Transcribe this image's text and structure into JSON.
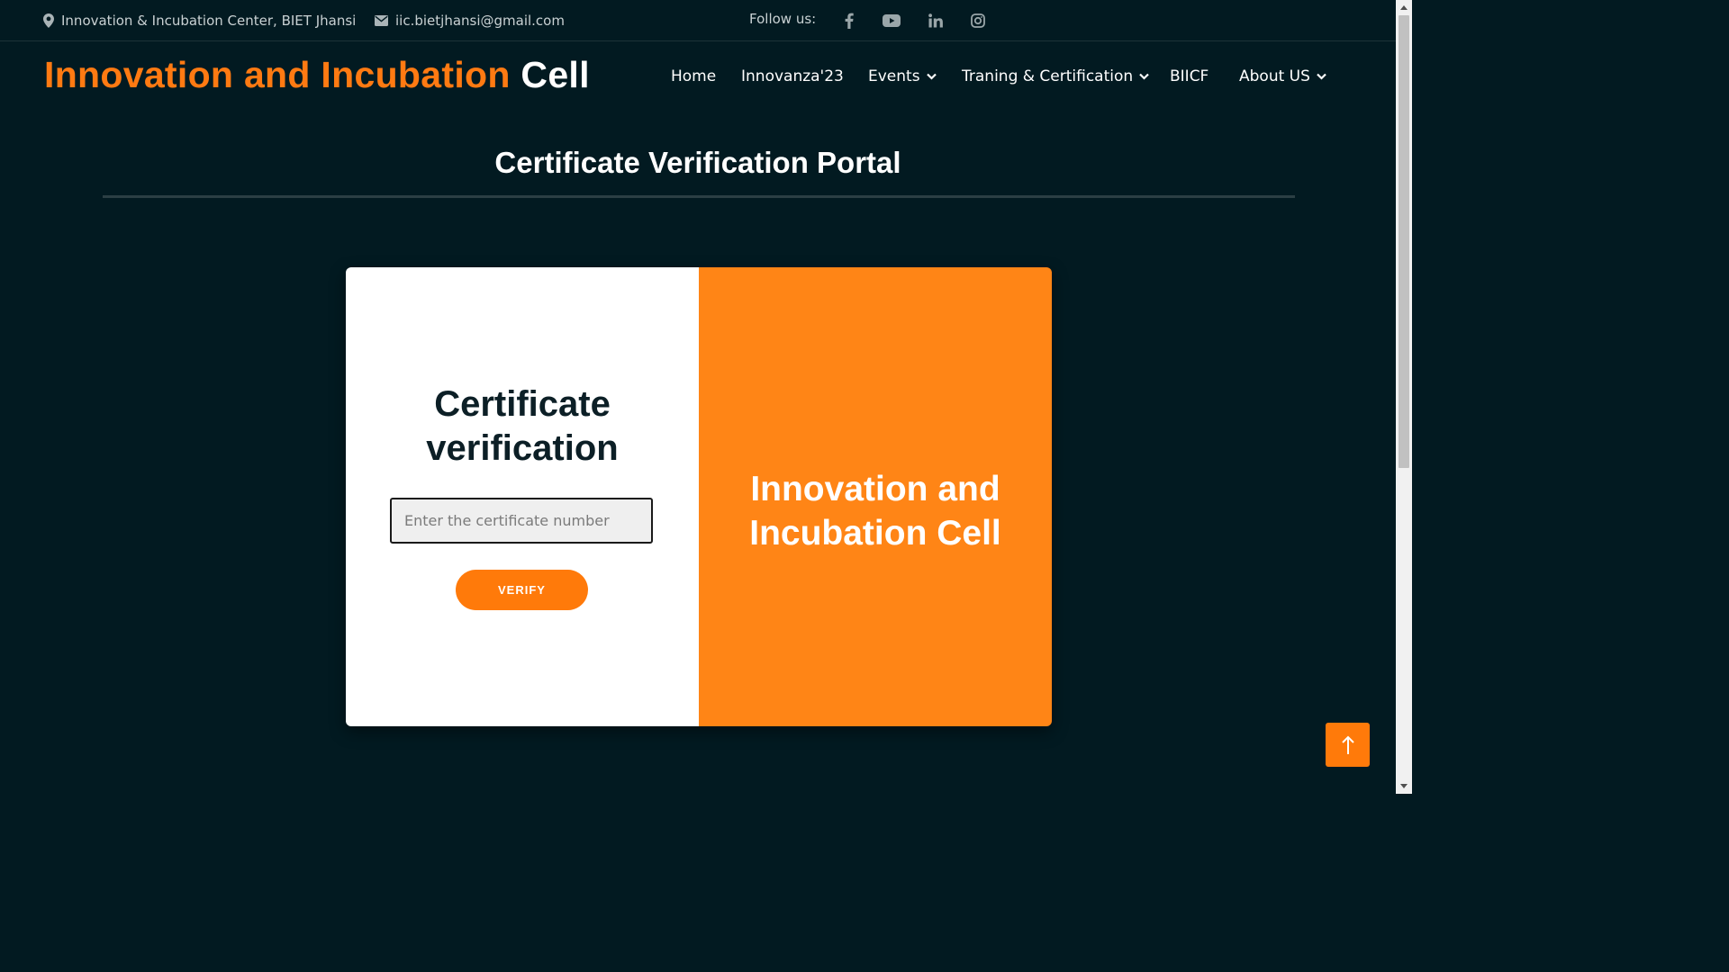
{
  "topbar": {
    "location": "Innovation & Incubation Center, BIET Jhansi",
    "email": "iic.bietjhansi@gmail.com",
    "follow_label": "Follow us:",
    "socials": [
      "facebook-icon",
      "youtube-icon",
      "linkedin-icon",
      "instagram-icon"
    ]
  },
  "brand": {
    "part1": "Innovation and Incubation",
    "part2": "Cell"
  },
  "nav": {
    "items": [
      {
        "label": "Home"
      },
      {
        "label": "Innovanza'23"
      },
      {
        "label": "Events"
      },
      {
        "label": "Traning & Certification"
      },
      {
        "label": "BIICF"
      },
      {
        "label": "About US"
      }
    ]
  },
  "main": {
    "title": "Certificate Verification Portal",
    "card": {
      "heading_line1": "Certificate",
      "heading_line2": "verification",
      "input_placeholder": "Enter the certificate number",
      "input_value": "",
      "button_label": "VERIFY",
      "promo_line1": "Innovation and",
      "promo_line2": "Incubation Cell"
    }
  },
  "colors": {
    "background": "#021a21",
    "accent": "#ff7a12",
    "panel_orange": "#ff8516",
    "card_white": "#ffffff"
  }
}
